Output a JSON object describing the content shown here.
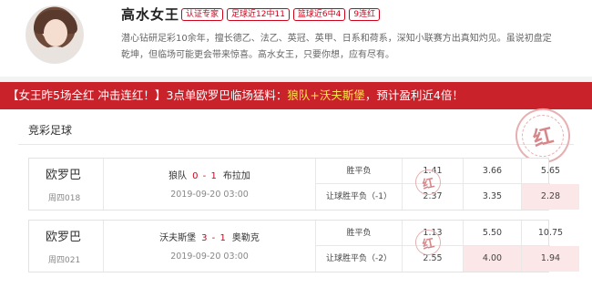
{
  "expert": {
    "name": "高水女王",
    "tags": [
      "认证专家",
      "足球近12中11",
      "篮球近6中4",
      "9连红"
    ],
    "bio": "潜心钻研足彩10余年，擅长德乙、法乙、英冠、英甲、日系和荷系，深知小联赛方出真知灼见。虽说初盘定乾坤，但临场可能更会带来惊喜。高水女王，只要你想，应有尽有。"
  },
  "banner": {
    "prefix": "【女王昨5场全红 冲击连红！】",
    "middle": "3点单欧罗巴临场猛料：",
    "teams": "狼队+沃夫斯堡",
    "suffix": "，预计盈利近4倍！"
  },
  "section_title": "竞彩足球",
  "stamp_char": "红",
  "colors": {
    "accent": "#d0021b",
    "banner_bg": "#c9222a",
    "highlight": "#ffe34d",
    "selected_bg": "#fbe7e7"
  },
  "matches": [
    {
      "league": "欧罗巴",
      "match_no": "周四018",
      "home": "狼队",
      "score": "0 - 1",
      "away": "布拉加",
      "time": "2019-09-20 03:00",
      "rows": [
        {
          "label": "胜平负",
          "odds": [
            "1.41",
            "3.66",
            "5.65"
          ],
          "selected": []
        },
        {
          "label": "让球胜平负（-1）",
          "odds": [
            "2.37",
            "3.35",
            "2.28"
          ],
          "selected": [
            2
          ]
        }
      ]
    },
    {
      "league": "欧罗巴",
      "match_no": "周四021",
      "home": "沃夫斯堡",
      "score": "3 - 1",
      "away": "奥勒克",
      "time": "2019-09-20 03:00",
      "rows": [
        {
          "label": "胜平负",
          "odds": [
            "1.13",
            "5.50",
            "10.75"
          ],
          "selected": []
        },
        {
          "label": "让球胜平负（-2）",
          "odds": [
            "2.55",
            "4.00",
            "1.94"
          ],
          "selected": [
            1,
            2
          ]
        }
      ]
    }
  ]
}
